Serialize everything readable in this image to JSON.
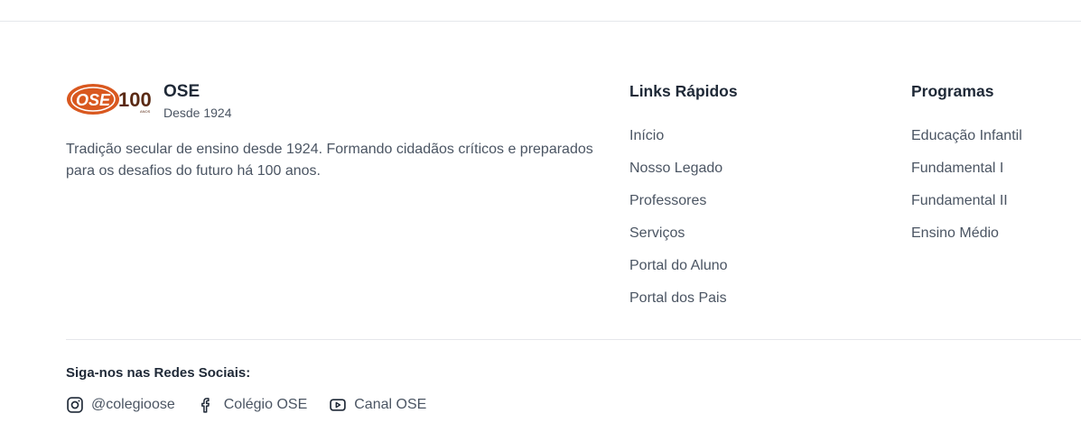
{
  "brand": {
    "name": "OSE",
    "since": "Desde 1924",
    "description": "Tradição secular de ensino desde 1924. Formando cidadãos críticos e preparados para os desafios do futuro há 100 anos.",
    "logo_mark": "OSE",
    "logo_years": "100",
    "logo_years_caption": "ANOS",
    "colors": {
      "logo_orange": "#d9581f",
      "logo_dark": "#5a2a14"
    }
  },
  "quick_links": {
    "title": "Links Rápidos",
    "items": [
      {
        "label": "Início"
      },
      {
        "label": "Nosso Legado"
      },
      {
        "label": "Professores"
      },
      {
        "label": "Serviços"
      },
      {
        "label": "Portal do Aluno"
      },
      {
        "label": "Portal dos Pais"
      }
    ]
  },
  "programs": {
    "title": "Programas",
    "items": [
      {
        "label": "Educação Infantil"
      },
      {
        "label": "Fundamental I"
      },
      {
        "label": "Fundamental II"
      },
      {
        "label": "Ensino Médio"
      }
    ]
  },
  "social": {
    "title": "Siga-nos nas Redes Sociais:",
    "items": [
      {
        "icon": "instagram-icon",
        "label": "@colegioose"
      },
      {
        "icon": "facebook-icon",
        "label": "Colégio OSE"
      },
      {
        "icon": "youtube-icon",
        "label": "Canal OSE"
      }
    ]
  }
}
